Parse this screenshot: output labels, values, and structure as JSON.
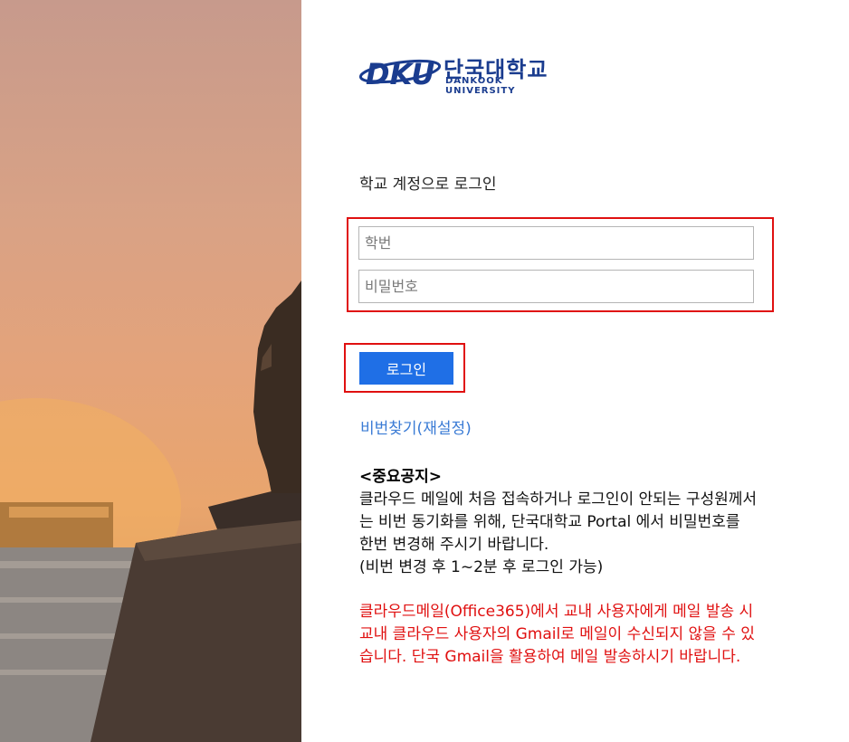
{
  "colors": {
    "accent": "#1f6fe6",
    "link": "#3a7bd5",
    "highlight_border": "#e01010",
    "brand": "#1a3c8f"
  },
  "logo": {
    "mark": "DKU",
    "korean": "단국대학교",
    "english": "DANKOOK UNIVERSITY"
  },
  "login": {
    "heading": "학교 계정으로 로그인",
    "id_placeholder": "학번",
    "password_placeholder": "비밀번호",
    "button_label": "로그인",
    "reset_link": "비번찾기(재설정)"
  },
  "notice": {
    "title": "<중요공지>",
    "body": "클라우드 메일에 처음 접속하거나 로그인이 안되는 구성원께서는 비번 동기화를 위해, 단국대학교 Portal 에서 비밀번호를 한번 변경해 주시기 바랍니다.",
    "body_note": "(비번 변경 후 1~2분 후 로그인 가능)",
    "warning": "클라우드메일(Office365)에서 교내 사용자에게 메일 발송 시 교내 클라우드 사용자의 Gmail로 메일이 수신되지 않을 수 있습니다. 단국 Gmail을 활용하여 메일 발송하시기 바랍니다."
  }
}
